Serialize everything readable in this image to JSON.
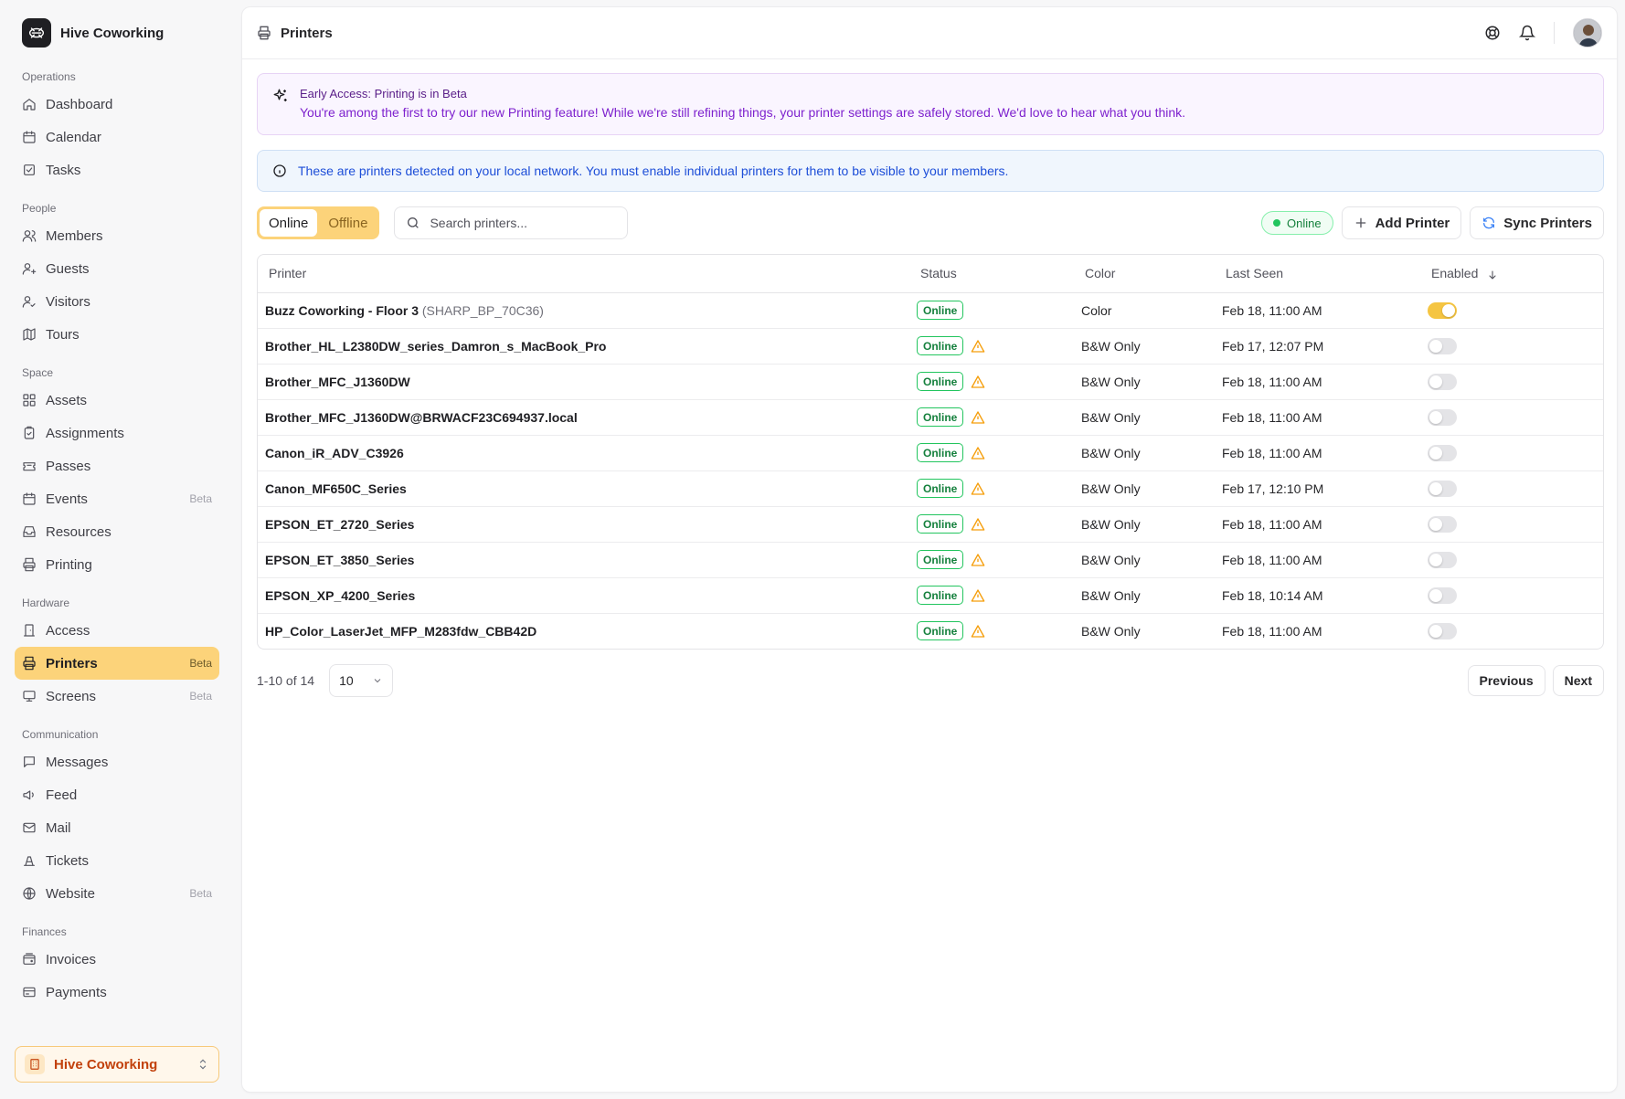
{
  "brand": {
    "name": "Hive Coworking"
  },
  "sidebar": {
    "sections": [
      {
        "title": "Operations",
        "items": [
          {
            "label": "Dashboard",
            "icon": "home-icon"
          },
          {
            "label": "Calendar",
            "icon": "calendar-icon"
          },
          {
            "label": "Tasks",
            "icon": "tasks-icon"
          }
        ]
      },
      {
        "title": "People",
        "items": [
          {
            "label": "Members",
            "icon": "users-icon"
          },
          {
            "label": "Guests",
            "icon": "user-plus-icon"
          },
          {
            "label": "Visitors",
            "icon": "user-check-icon"
          },
          {
            "label": "Tours",
            "icon": "map-icon"
          }
        ]
      },
      {
        "title": "Space",
        "items": [
          {
            "label": "Assets",
            "icon": "grid-icon"
          },
          {
            "label": "Assignments",
            "icon": "clipboard-icon"
          },
          {
            "label": "Passes",
            "icon": "ticket-icon"
          },
          {
            "label": "Events",
            "icon": "calendar-icon",
            "badge": "Beta"
          },
          {
            "label": "Resources",
            "icon": "inbox-icon"
          },
          {
            "label": "Printing",
            "icon": "printer-icon"
          }
        ]
      },
      {
        "title": "Hardware",
        "items": [
          {
            "label": "Access",
            "icon": "door-icon"
          },
          {
            "label": "Printers",
            "icon": "printer-icon",
            "badge": "Beta",
            "active": true
          },
          {
            "label": "Screens",
            "icon": "monitor-icon",
            "badge": "Beta"
          }
        ]
      },
      {
        "title": "Communication",
        "items": [
          {
            "label": "Messages",
            "icon": "message-icon"
          },
          {
            "label": "Feed",
            "icon": "megaphone-icon"
          },
          {
            "label": "Mail",
            "icon": "mail-icon"
          },
          {
            "label": "Tickets",
            "icon": "bell-ticket-icon"
          },
          {
            "label": "Website",
            "icon": "globe-icon",
            "badge": "Beta"
          }
        ]
      },
      {
        "title": "Finances",
        "items": [
          {
            "label": "Invoices",
            "icon": "wallet-icon"
          },
          {
            "label": "Payments",
            "icon": "credit-card-icon"
          }
        ]
      }
    ],
    "workspace": "Hive Coworking"
  },
  "header": {
    "title": "Printers"
  },
  "beta_banner": {
    "title": "Early Access: Printing is in Beta",
    "text": "You're among the first to try our new Printing feature! While we're still refining things, your printer settings are safely stored. We'd love to hear what you think."
  },
  "info_banner": {
    "text": "These are printers detected on your local network. You must enable individual printers for them to be visible to your members."
  },
  "toolbar": {
    "tab_online": "Online",
    "tab_offline": "Offline",
    "search_placeholder": "Search printers...",
    "status": "Online",
    "add_label": "Add Printer",
    "sync_label": "Sync Printers"
  },
  "table": {
    "headers": {
      "printer": "Printer",
      "status": "Status",
      "color": "Color",
      "last_seen": "Last Seen",
      "enabled": "Enabled"
    },
    "rows": [
      {
        "name": "Buzz Coworking - Floor 3",
        "sub": "(SHARP_BP_70C36)",
        "status": "Online",
        "warning": false,
        "color": "Color",
        "last_seen": "Feb 18, 11:00 AM",
        "enabled": true
      },
      {
        "name": "Brother_HL_L2380DW_series_Damron_s_MacBook_Pro",
        "sub": "",
        "status": "Online",
        "warning": true,
        "color": "B&W Only",
        "last_seen": "Feb 17, 12:07 PM",
        "enabled": false
      },
      {
        "name": "Brother_MFC_J1360DW",
        "sub": "",
        "status": "Online",
        "warning": true,
        "color": "B&W Only",
        "last_seen": "Feb 18, 11:00 AM",
        "enabled": false
      },
      {
        "name": "Brother_MFC_J1360DW@BRWACF23C694937.local",
        "sub": "",
        "status": "Online",
        "warning": true,
        "color": "B&W Only",
        "last_seen": "Feb 18, 11:00 AM",
        "enabled": false
      },
      {
        "name": "Canon_iR_ADV_C3926",
        "sub": "",
        "status": "Online",
        "warning": true,
        "color": "B&W Only",
        "last_seen": "Feb 18, 11:00 AM",
        "enabled": false
      },
      {
        "name": "Canon_MF650C_Series",
        "sub": "",
        "status": "Online",
        "warning": true,
        "color": "B&W Only",
        "last_seen": "Feb 17, 12:10 PM",
        "enabled": false
      },
      {
        "name": "EPSON_ET_2720_Series",
        "sub": "",
        "status": "Online",
        "warning": true,
        "color": "B&W Only",
        "last_seen": "Feb 18, 11:00 AM",
        "enabled": false
      },
      {
        "name": "EPSON_ET_3850_Series",
        "sub": "",
        "status": "Online",
        "warning": true,
        "color": "B&W Only",
        "last_seen": "Feb 18, 11:00 AM",
        "enabled": false
      },
      {
        "name": "EPSON_XP_4200_Series",
        "sub": "",
        "status": "Online",
        "warning": true,
        "color": "B&W Only",
        "last_seen": "Feb 18, 10:14 AM",
        "enabled": false
      },
      {
        "name": "HP_Color_LaserJet_MFP_M283fdw_CBB42D",
        "sub": "",
        "status": "Online",
        "warning": true,
        "color": "B&W Only",
        "last_seen": "Feb 18, 11:00 AM",
        "enabled": false
      }
    ]
  },
  "pagination": {
    "range": "1-10 of 14",
    "page_size": "10",
    "previous": "Previous",
    "next": "Next"
  },
  "colors": {
    "accent": "#fcd37a",
    "online": "#22c55e",
    "warning": "#f59e0b",
    "beta_text": "#7e22ce",
    "info_text": "#1d4ed8"
  }
}
